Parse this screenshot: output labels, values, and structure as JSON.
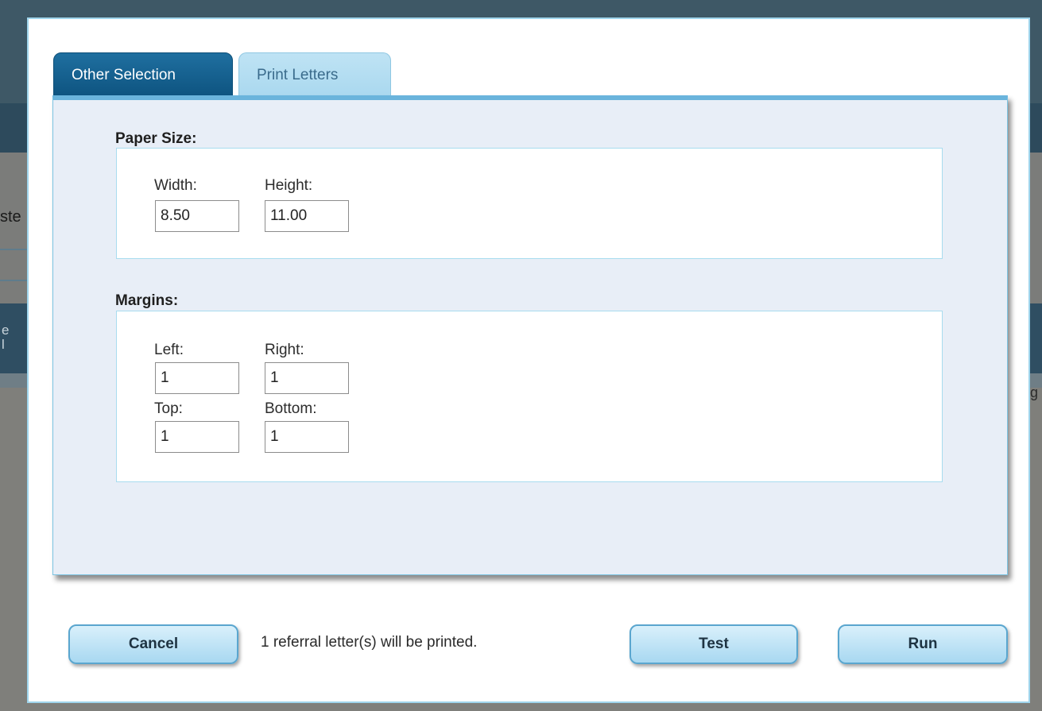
{
  "background": {
    "fragment_left_1": "ste",
    "fragment_left_2a": "e",
    "fragment_left_2b": "l",
    "fragment_right": "g"
  },
  "tabs": [
    {
      "label": "Other Selection",
      "active": true
    },
    {
      "label": "Print Letters",
      "active": false
    }
  ],
  "paper_size": {
    "heading": "Paper Size:",
    "width_label": "Width:",
    "width_value": "8.50",
    "height_label": "Height:",
    "height_value": "11.00"
  },
  "margins": {
    "heading": "Margins:",
    "left_label": "Left:",
    "left_value": "1",
    "right_label": "Right:",
    "right_value": "1",
    "top_label": "Top:",
    "top_value": "1",
    "bottom_label": "Bottom:",
    "bottom_value": "1"
  },
  "footer": {
    "cancel_label": "Cancel",
    "status": "1 referral letter(s) will be printed.",
    "test_label": "Test",
    "run_label": "Run"
  },
  "colors": {
    "active_tab": "#1f6fa0",
    "inactive_tab": "#bfe3f4",
    "panel_background": "#e8eef7",
    "modal_border": "#9fd5ec",
    "button_fill": "#a8d8f1"
  }
}
